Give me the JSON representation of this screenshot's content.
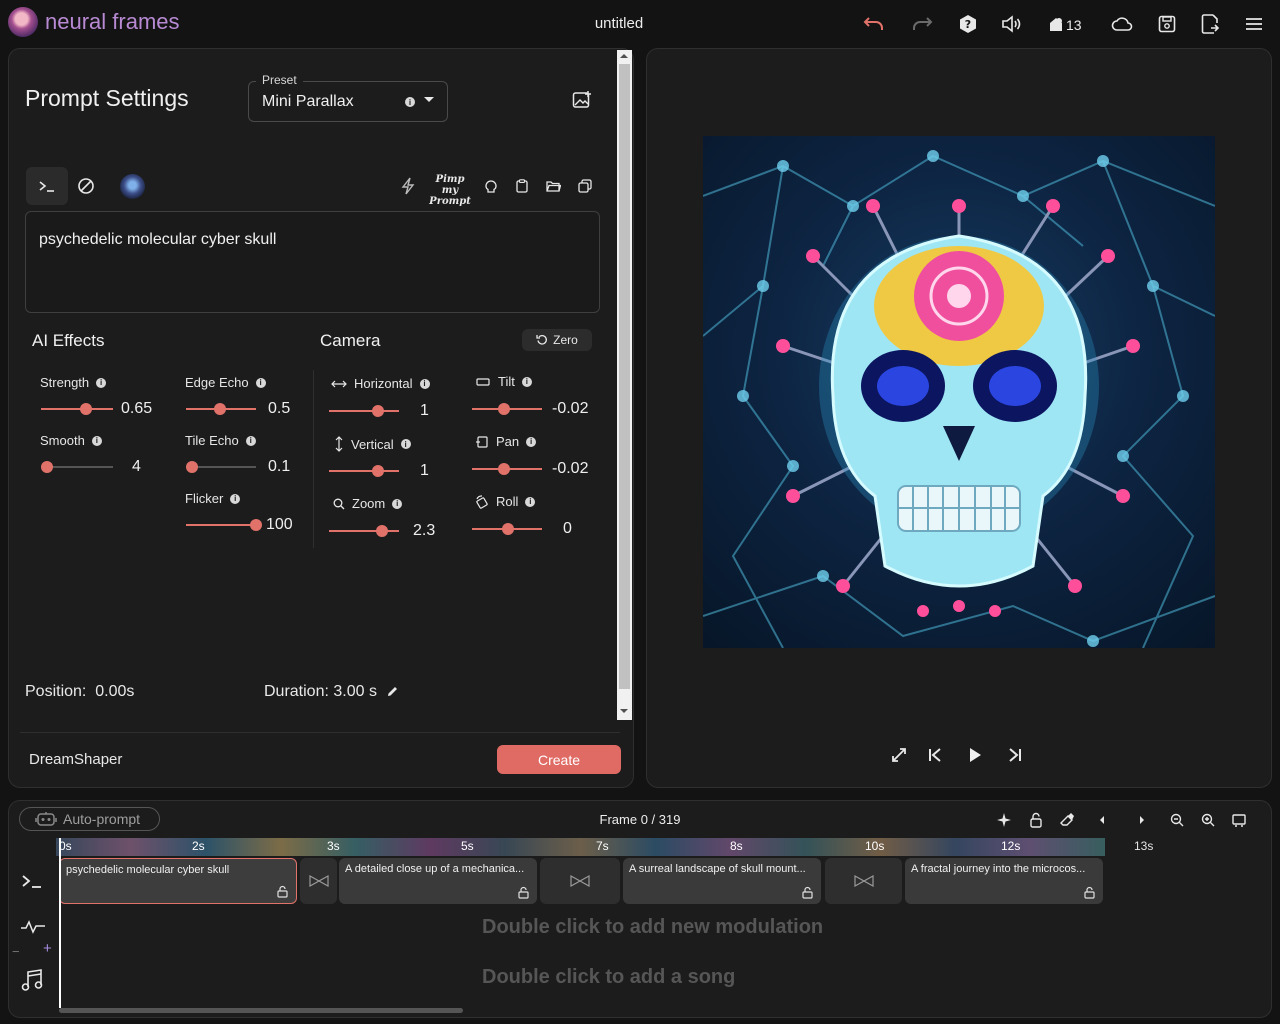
{
  "app": {
    "brand": "neural frames",
    "doc_title": "untitled",
    "credits": "13"
  },
  "prompt_settings": {
    "heading": "Prompt Settings",
    "preset_label": "Preset",
    "preset_value": "Mini Parallax",
    "prompt_text": "psychedelic molecular cyber skull",
    "pimp_label": "Pimp my Prompt"
  },
  "ai_effects": {
    "title": "AI Effects",
    "items": [
      {
        "label": "Strength",
        "value": "0.65",
        "fraction": 0.65
      },
      {
        "label": "Smooth",
        "value": "4",
        "fraction": 0.0
      },
      {
        "label": "Edge Echo",
        "value": "0.5",
        "fraction": 0.5
      },
      {
        "label": "Tile Echo",
        "value": "0.1",
        "fraction": 0.1
      },
      {
        "label": "Flicker",
        "value": "100",
        "fraction": 1.0
      }
    ]
  },
  "camera": {
    "title": "Camera",
    "zero_label": "Zero",
    "items": [
      {
        "label": "Horizontal",
        "value": "1",
        "fraction": 0.68
      },
      {
        "label": "Vertical",
        "value": "1",
        "fraction": 0.68
      },
      {
        "label": "Zoom",
        "value": "2.3",
        "fraction": 0.73
      },
      {
        "label": "Tilt",
        "value": "-0.02",
        "fraction": 0.45
      },
      {
        "label": "Pan",
        "value": "-0.02",
        "fraction": 0.45
      },
      {
        "label": "Roll",
        "value": "0",
        "fraction": 0.5
      }
    ]
  },
  "footer": {
    "position_label": "Position:",
    "position_value": "0.00s",
    "duration_label": "Duration:",
    "duration_value": "3.00 s",
    "model": "DreamShaper",
    "create_label": "Create"
  },
  "timeline": {
    "autoprompt_label": "Auto-prompt",
    "frame_label": "Frame 0 / 319",
    "ticks": [
      "0s",
      "2s",
      "3s",
      "5s",
      "7s",
      "8s",
      "10s",
      "12s",
      "13s"
    ],
    "clips": [
      "psychedelic molecular cyber skull",
      "A detailed close up of a mechanica...",
      "A surreal landscape of skull mount...",
      "A fractal journey into the microcos..."
    ],
    "modulation_hint": "Double click to add new modulation",
    "song_hint": "Double click to add a song"
  },
  "colors": {
    "accent": "#df6b64",
    "brand": "#b88ad3",
    "background": "#131313",
    "panel": "#1c1c1c"
  },
  "icons": [
    "undo-icon",
    "redo-icon",
    "help-icon",
    "volume-icon",
    "credits-icon",
    "cloud-icon",
    "save-icon",
    "export-icon",
    "menu-icon",
    "image-add-icon",
    "terminal-icon",
    "negative-prompt-icon",
    "lightning-icon",
    "brain-icon",
    "clipboard-icon",
    "folder-icon",
    "copy-icon",
    "expand-icon",
    "skip-back-icon",
    "play-icon",
    "skip-forward-icon",
    "sparkle-icon",
    "lock-icon",
    "eraser-icon",
    "zoom-out-icon",
    "zoom-in-icon",
    "fit-icon",
    "waveform-icon",
    "music-icon"
  ]
}
